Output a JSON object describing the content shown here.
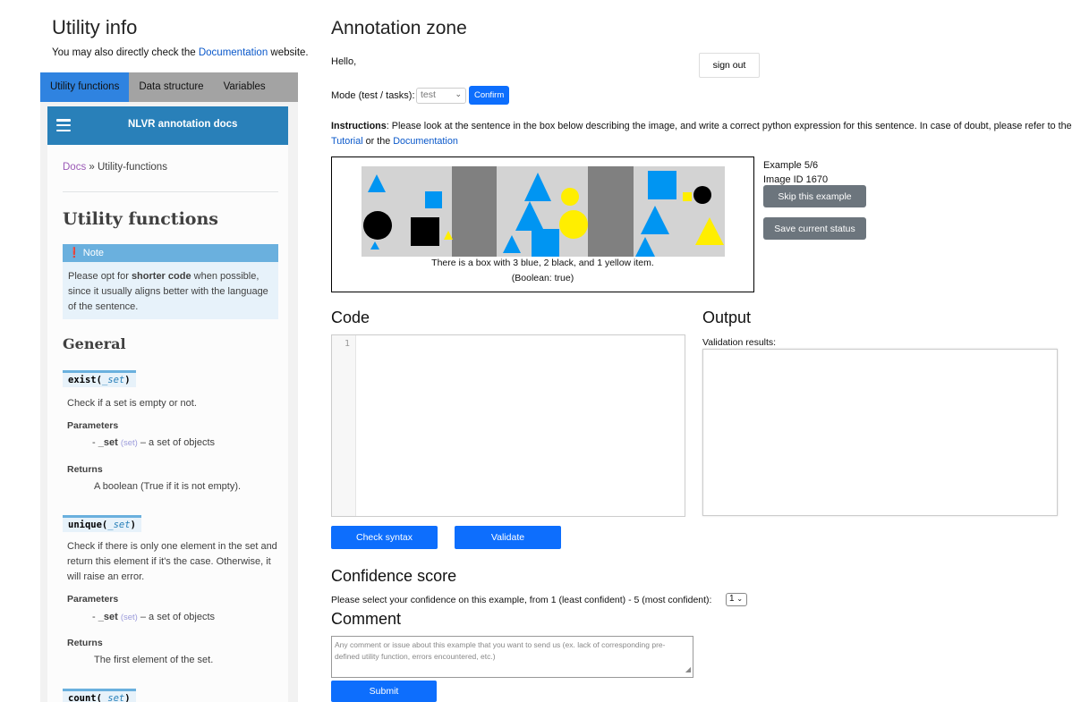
{
  "left": {
    "title": "Utility info",
    "subtitle_pre": "You may also directly check the ",
    "subtitle_link": "Documentation",
    "subtitle_post": " website.",
    "tabs": [
      "Utility functions",
      "Data structure",
      "Variables"
    ],
    "docs": {
      "header_title": "NLVR annotation docs",
      "breadcrumb_link": "Docs",
      "breadcrumb_rest": " » Utility-functions",
      "h1": "Utility functions",
      "note_head": "Note",
      "note_pre": "Please opt for ",
      "note_bold": "shorter code",
      "note_post": " when possible, since it usually aligns better with the language of the sentence.",
      "h2": "General",
      "fn1_name": "exist(",
      "fn1_arg": "_set",
      "fn1_close": ")",
      "fn1_desc": "Check if a set is empty or not.",
      "params_label": "Parameters",
      "param_bullet": "- ",
      "param_name": "_set",
      "param_type": "(set)",
      "param_desc": " – a set of objects",
      "returns_label": "Returns",
      "fn1_ret": "A boolean (True if it is not empty).",
      "fn2_name": "unique(",
      "fn2_arg": "_set",
      "fn2_close": ")",
      "fn2_desc": "Check if there is only one element in the set and return this element if it's the case. Otherwise, it will raise an error.",
      "fn2_ret": "The first element of the set.",
      "fn3_name": "count(",
      "fn3_arg": "_set",
      "fn3_close": ")"
    }
  },
  "main": {
    "title": "Annotation zone",
    "hello": "Hello,",
    "signout": "sign out",
    "mode_label": "Mode (test / tasks):",
    "mode_value": "test",
    "confirm": "Confirm",
    "instr_bold": "Instructions",
    "instr_text": ": Please look at the sentence in the box below describing the image, and write a correct python expression for this sentence. In case of doubt, please refer to the ",
    "instr_link1": "Tutorial",
    "instr_or": " or the ",
    "instr_link2": "Documentation",
    "caption": "There is a box with 3 blue, 2 black, and 1 yellow item.",
    "caption_bool": "(Boolean: true)",
    "example": "Example 5/6",
    "image_id": "Image ID 1670",
    "skip": "Skip this example",
    "save": "Save current status",
    "code_title": "Code",
    "line_no": "1",
    "output_title": "Output",
    "validation_label": "Validation results:",
    "check_syntax": "Check syntax",
    "validate": "Validate",
    "conf_title": "Confidence score",
    "conf_label": "Please select your confidence on this example, from 1 (least confident) - 5 (most confident):",
    "conf_value": "1",
    "comment_title": "Comment",
    "comment_placeholder": "Any comment or issue about this example that you want to send us (ex. lack of corresponding pre-defined utility function, errors encountered, etc.)",
    "submit": "Submit"
  },
  "colors": {
    "blue": "#0d6efd",
    "gray_button": "#6c757d",
    "docs_header": "#2980b9",
    "shape_blue": "#0095f2",
    "shape_yellow": "#ffee00"
  }
}
